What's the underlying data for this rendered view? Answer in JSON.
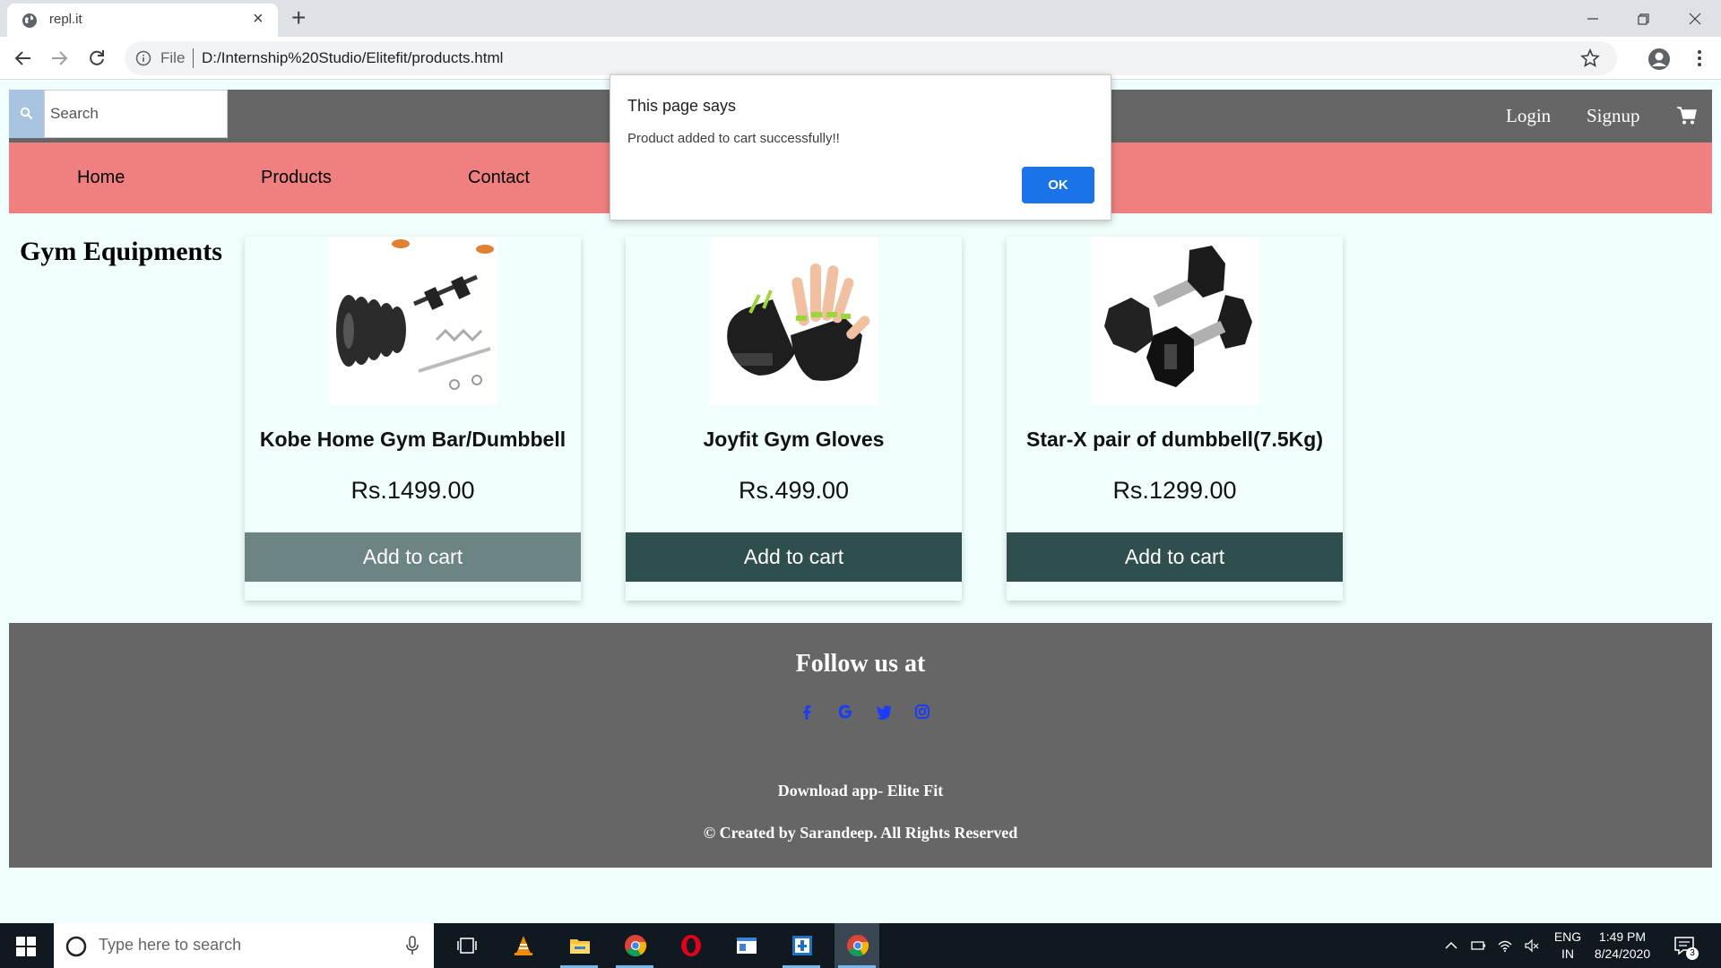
{
  "browser": {
    "tab_title": "repl.it",
    "new_tab": "+",
    "address_prefix": "File",
    "url": "D:/Internship%20Studio/Elitefit/products.html"
  },
  "header": {
    "search_placeholder": "Search",
    "login": "Login",
    "signup": "Signup"
  },
  "nav": {
    "items": [
      "Home",
      "Products",
      "Contact"
    ]
  },
  "main": {
    "section_title": "Gym Equipments",
    "products": [
      {
        "name": "Kobe Home Gym Bar/Dumbbell",
        "price": "Rs.1499.00",
        "button": "Add to cart"
      },
      {
        "name": "Joyfit Gym Gloves",
        "price": "Rs.499.00",
        "button": "Add to cart"
      },
      {
        "name": "Star-X pair of dumbbell(7.5Kg)",
        "price": "Rs.1299.00",
        "button": "Add to cart"
      }
    ]
  },
  "footer": {
    "follow": "Follow us at",
    "social_icons": [
      "facebook-icon",
      "google-icon",
      "twitter-icon",
      "instagram-icon"
    ],
    "download": "Download app- Elite Fit",
    "copyright": "© Created by Sarandeep. All Rights Reserved"
  },
  "alert": {
    "title": "This page says",
    "message": "Product added to cart successfully!!",
    "ok": "OK"
  },
  "taskbar": {
    "search_placeholder": "Type here to search",
    "lang_line1": "ENG",
    "lang_line2": "IN",
    "time": "1:49 PM",
    "date": "8/24/2020",
    "notification_count": "3"
  },
  "colors": {
    "topbar": "#666666",
    "navbar": "#f08080",
    "button": "#2f4f4f",
    "page_bg": "#f0fefe",
    "social": "#1a3cff"
  }
}
